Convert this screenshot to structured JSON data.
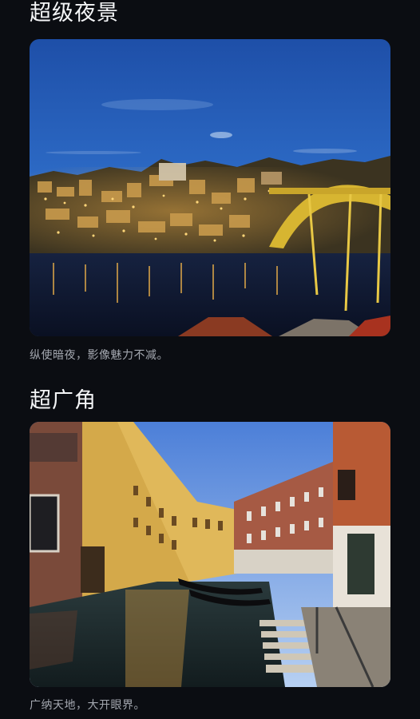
{
  "sections": [
    {
      "title": "超级夜景",
      "caption": "纵使暗夜，影像魅力不减。",
      "image_subject": "night-cityscape-bridge"
    },
    {
      "title": "超广角",
      "caption": "广纳天地，大开眼界。",
      "image_subject": "venice-canal-wide-angle"
    }
  ],
  "colors": {
    "background": "#0b0d12",
    "title": "#f4f5f7",
    "caption": "#a4a8b0"
  }
}
